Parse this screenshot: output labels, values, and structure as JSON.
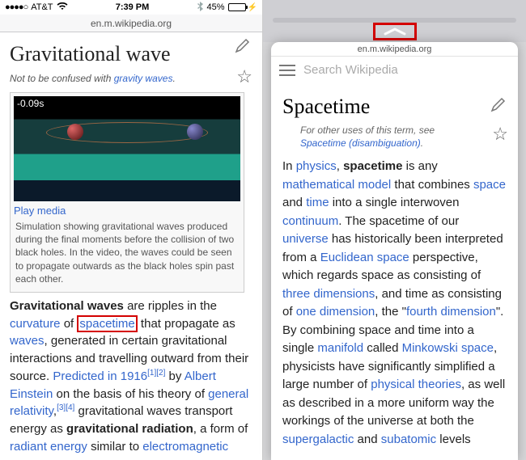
{
  "statusbar": {
    "carrier": "AT&T",
    "signal_dots": "●●●●○",
    "time": "7:39 PM",
    "battery_pct": "45%"
  },
  "left": {
    "url": "en.m.wikipedia.org",
    "title": "Gravitational wave",
    "hatnote_prefix": "Not to be confused with ",
    "hatnote_link": "gravity waves",
    "hatnote_suffix": ".",
    "media_time": "-0.09s",
    "play_label": "Play media",
    "media_caption": "Simulation showing gravitational waves produced during the final moments before the collision of two black holes. In the video, the waves could be seen to propagate outwards as the black holes spin past each other.",
    "para1": {
      "t0_bold": "Gravitational waves",
      "t1": " are ripples in the ",
      "link_curvature": "curvature",
      "t2": " of ",
      "link_spacetime": "spacetime",
      "t3": " that propagate as ",
      "link_waves": "waves",
      "t4": ", generated in certain gravitational interactions and travelling outward from their source. ",
      "link_predicted": "Predicted in 1916",
      "ref1": "[1]",
      "ref2": "[2]",
      "t5": " by ",
      "link_einstein": "Albert Einstein",
      "t6": " on the basis of his theory of ",
      "link_gr": "general relativity",
      "t7": ",",
      "ref3": "[3]",
      "ref4": "[4]",
      "t8": " gravitational waves transport energy as ",
      "t9_bold": "gravitational radiation",
      "t10": ", a form of ",
      "link_radiant": "radiant energy",
      "t11": " similar to ",
      "link_em": "electromagnetic"
    }
  },
  "right": {
    "url": "en.m.wikipedia.org",
    "search_placeholder": "Search Wikipedia",
    "title": "Spacetime",
    "hatnote_prefix": "For other uses of this term, see ",
    "hatnote_link": "Spacetime (disambiguation)",
    "hatnote_suffix": ".",
    "para": {
      "t0": "In ",
      "l_physics": "physics",
      "t1": ", ",
      "b_spacetime": "spacetime",
      "t2": " is any ",
      "l_mathmodel": "mathematical model",
      "t3": " that combines ",
      "l_space": "space",
      "t4": " and ",
      "l_time": "time",
      "t5": " into a single interwoven ",
      "l_continuum": "continuum",
      "t6": ". The spacetime of our ",
      "l_universe": "universe",
      "t7": " has historically been interpreted from a ",
      "l_euclid": "Euclidean space",
      "t8": " perspective, which regards space as consisting of ",
      "l_3d": "three dimensions",
      "t9": ", and time as consisting of ",
      "l_1d": "one dimension",
      "t10": ", the \"",
      "l_4d": "fourth dimension",
      "t11": "\". By combining space and time into a single ",
      "l_manifold": "manifold",
      "t12": " called ",
      "l_mink": "Minkowski space",
      "t13": ", physicists have significantly simplified a large number of ",
      "l_phys": "physical theories",
      "t14": ", as well as described in a more uniform way the workings of the universe at both the ",
      "l_sg": "supergalactic",
      "t15": " and ",
      "l_sub": "subatomic",
      "t16": " levels"
    }
  }
}
